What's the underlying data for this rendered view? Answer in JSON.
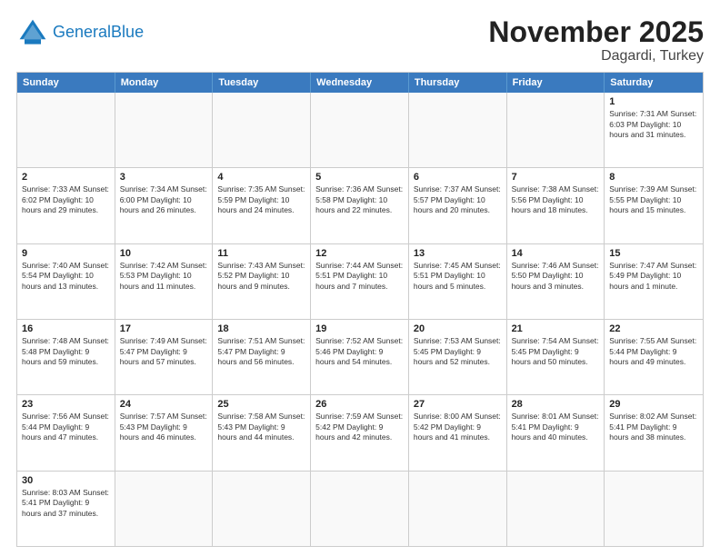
{
  "header": {
    "logo_general": "General",
    "logo_blue": "Blue",
    "title": "November 2025",
    "subtitle": "Dagardi, Turkey"
  },
  "days_of_week": [
    "Sunday",
    "Monday",
    "Tuesday",
    "Wednesday",
    "Thursday",
    "Friday",
    "Saturday"
  ],
  "weeks": [
    [
      {
        "day": "",
        "info": ""
      },
      {
        "day": "",
        "info": ""
      },
      {
        "day": "",
        "info": ""
      },
      {
        "day": "",
        "info": ""
      },
      {
        "day": "",
        "info": ""
      },
      {
        "day": "",
        "info": ""
      },
      {
        "day": "1",
        "info": "Sunrise: 7:31 AM\nSunset: 6:03 PM\nDaylight: 10 hours\nand 31 minutes."
      }
    ],
    [
      {
        "day": "2",
        "info": "Sunrise: 7:33 AM\nSunset: 6:02 PM\nDaylight: 10 hours\nand 29 minutes."
      },
      {
        "day": "3",
        "info": "Sunrise: 7:34 AM\nSunset: 6:00 PM\nDaylight: 10 hours\nand 26 minutes."
      },
      {
        "day": "4",
        "info": "Sunrise: 7:35 AM\nSunset: 5:59 PM\nDaylight: 10 hours\nand 24 minutes."
      },
      {
        "day": "5",
        "info": "Sunrise: 7:36 AM\nSunset: 5:58 PM\nDaylight: 10 hours\nand 22 minutes."
      },
      {
        "day": "6",
        "info": "Sunrise: 7:37 AM\nSunset: 5:57 PM\nDaylight: 10 hours\nand 20 minutes."
      },
      {
        "day": "7",
        "info": "Sunrise: 7:38 AM\nSunset: 5:56 PM\nDaylight: 10 hours\nand 18 minutes."
      },
      {
        "day": "8",
        "info": "Sunrise: 7:39 AM\nSunset: 5:55 PM\nDaylight: 10 hours\nand 15 minutes."
      }
    ],
    [
      {
        "day": "9",
        "info": "Sunrise: 7:40 AM\nSunset: 5:54 PM\nDaylight: 10 hours\nand 13 minutes."
      },
      {
        "day": "10",
        "info": "Sunrise: 7:42 AM\nSunset: 5:53 PM\nDaylight: 10 hours\nand 11 minutes."
      },
      {
        "day": "11",
        "info": "Sunrise: 7:43 AM\nSunset: 5:52 PM\nDaylight: 10 hours\nand 9 minutes."
      },
      {
        "day": "12",
        "info": "Sunrise: 7:44 AM\nSunset: 5:51 PM\nDaylight: 10 hours\nand 7 minutes."
      },
      {
        "day": "13",
        "info": "Sunrise: 7:45 AM\nSunset: 5:51 PM\nDaylight: 10 hours\nand 5 minutes."
      },
      {
        "day": "14",
        "info": "Sunrise: 7:46 AM\nSunset: 5:50 PM\nDaylight: 10 hours\nand 3 minutes."
      },
      {
        "day": "15",
        "info": "Sunrise: 7:47 AM\nSunset: 5:49 PM\nDaylight: 10 hours\nand 1 minute."
      }
    ],
    [
      {
        "day": "16",
        "info": "Sunrise: 7:48 AM\nSunset: 5:48 PM\nDaylight: 9 hours\nand 59 minutes."
      },
      {
        "day": "17",
        "info": "Sunrise: 7:49 AM\nSunset: 5:47 PM\nDaylight: 9 hours\nand 57 minutes."
      },
      {
        "day": "18",
        "info": "Sunrise: 7:51 AM\nSunset: 5:47 PM\nDaylight: 9 hours\nand 56 minutes."
      },
      {
        "day": "19",
        "info": "Sunrise: 7:52 AM\nSunset: 5:46 PM\nDaylight: 9 hours\nand 54 minutes."
      },
      {
        "day": "20",
        "info": "Sunrise: 7:53 AM\nSunset: 5:45 PM\nDaylight: 9 hours\nand 52 minutes."
      },
      {
        "day": "21",
        "info": "Sunrise: 7:54 AM\nSunset: 5:45 PM\nDaylight: 9 hours\nand 50 minutes."
      },
      {
        "day": "22",
        "info": "Sunrise: 7:55 AM\nSunset: 5:44 PM\nDaylight: 9 hours\nand 49 minutes."
      }
    ],
    [
      {
        "day": "23",
        "info": "Sunrise: 7:56 AM\nSunset: 5:44 PM\nDaylight: 9 hours\nand 47 minutes."
      },
      {
        "day": "24",
        "info": "Sunrise: 7:57 AM\nSunset: 5:43 PM\nDaylight: 9 hours\nand 46 minutes."
      },
      {
        "day": "25",
        "info": "Sunrise: 7:58 AM\nSunset: 5:43 PM\nDaylight: 9 hours\nand 44 minutes."
      },
      {
        "day": "26",
        "info": "Sunrise: 7:59 AM\nSunset: 5:42 PM\nDaylight: 9 hours\nand 42 minutes."
      },
      {
        "day": "27",
        "info": "Sunrise: 8:00 AM\nSunset: 5:42 PM\nDaylight: 9 hours\nand 41 minutes."
      },
      {
        "day": "28",
        "info": "Sunrise: 8:01 AM\nSunset: 5:41 PM\nDaylight: 9 hours\nand 40 minutes."
      },
      {
        "day": "29",
        "info": "Sunrise: 8:02 AM\nSunset: 5:41 PM\nDaylight: 9 hours\nand 38 minutes."
      }
    ],
    [
      {
        "day": "30",
        "info": "Sunrise: 8:03 AM\nSunset: 5:41 PM\nDaylight: 9 hours\nand 37 minutes."
      },
      {
        "day": "",
        "info": ""
      },
      {
        "day": "",
        "info": ""
      },
      {
        "day": "",
        "info": ""
      },
      {
        "day": "",
        "info": ""
      },
      {
        "day": "",
        "info": ""
      },
      {
        "day": "",
        "info": ""
      }
    ]
  ]
}
